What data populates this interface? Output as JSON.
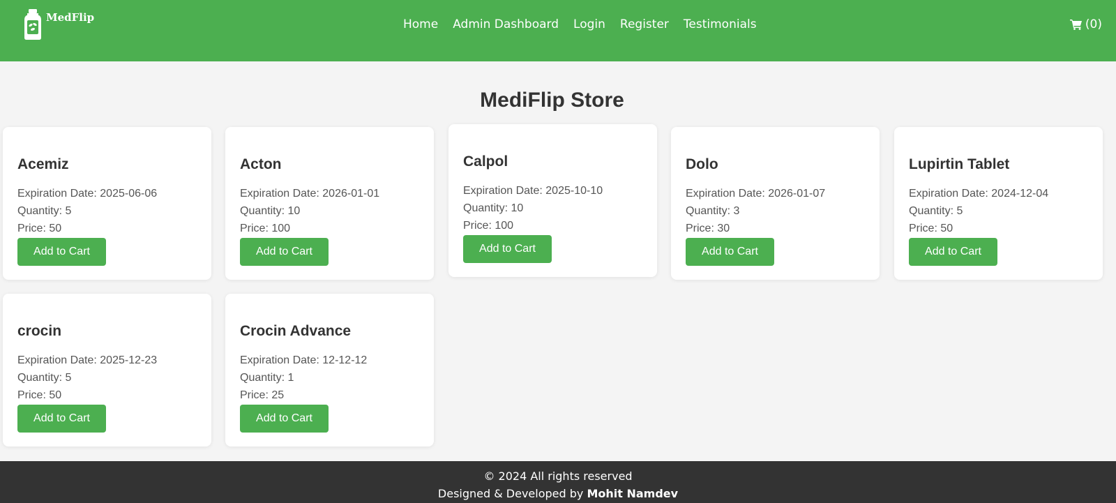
{
  "header": {
    "logo_text": "MedFlip",
    "nav": [
      "Home",
      "Admin Dashboard",
      "Login",
      "Register",
      "Testimonials"
    ],
    "cart_label": "(0)",
    "cart_icon": "shopping-cart-icon",
    "bg_color": "#4caf50"
  },
  "main": {
    "title": "MediFlip Store",
    "button_label": "Add to Cart",
    "products": [
      {
        "name": "Acemiz",
        "expiration": "Expiration Date: 2025-06-06",
        "quantity": "Quantity: 5",
        "price": "Price: 50"
      },
      {
        "name": "Acton",
        "expiration": "Expiration Date: 2026-01-01",
        "quantity": "Quantity: 10",
        "price": "Price: 100"
      },
      {
        "name": "Calpol",
        "expiration": "Expiration Date: 2025-10-10",
        "quantity": "Quantity: 10",
        "price": "Price: 100"
      },
      {
        "name": "Dolo",
        "expiration": "Expiration Date: 2026-01-07",
        "quantity": "Quantity: 3",
        "price": "Price: 30"
      },
      {
        "name": "Lupirtin Tablet",
        "expiration": "Expiration Date: 2024-12-04",
        "quantity": "Quantity: 5",
        "price": "Price: 50"
      },
      {
        "name": "crocin",
        "expiration": "Expiration Date: 2025-12-23",
        "quantity": "Quantity: 5",
        "price": "Price: 50"
      },
      {
        "name": "Crocin Advance",
        "expiration": "Expiration Date: 12-12-12",
        "quantity": "Quantity: 1",
        "price": "Price: 25"
      }
    ]
  },
  "footer": {
    "copyright": "© 2024 All rights reserved",
    "credit_prefix": "Designed & Developed by",
    "credit_name": "Mohit Namdev"
  }
}
